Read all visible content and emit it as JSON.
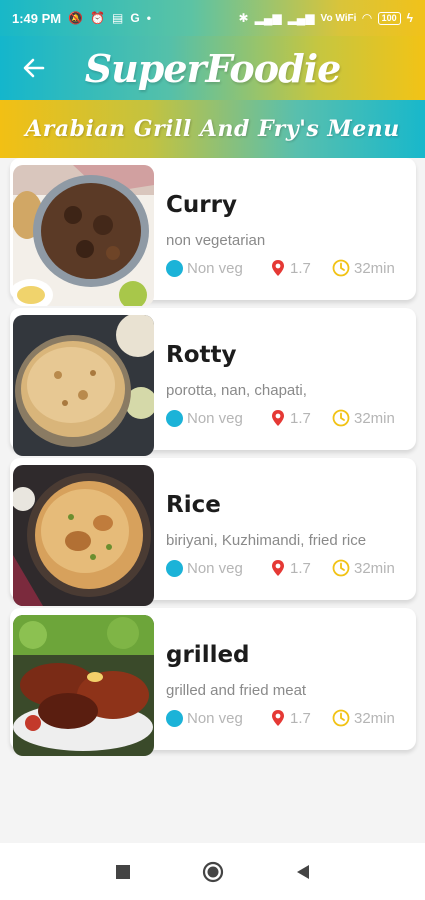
{
  "status_bar": {
    "time": "1:49 PM",
    "network_label": "Vo WiFi",
    "battery": "100"
  },
  "app_bar": {
    "title": "SuperFoodie"
  },
  "menu": {
    "title": "Arabian Grill And Fry's Menu"
  },
  "items": [
    {
      "name": "Curry",
      "description": "non vegetarian",
      "type": "Non veg",
      "rating": "1.7",
      "time": "32min"
    },
    {
      "name": "Rotty",
      "description": "porotta, nan, chapati,",
      "type": "Non veg",
      "rating": "1.7",
      "time": "32min"
    },
    {
      "name": "Rice",
      "description": "biriyani, Kuzhimandi, fried rice",
      "type": "Non veg",
      "rating": "1.7",
      "time": "32min"
    },
    {
      "name": "grilled",
      "description": "grilled and fried meat",
      "type": "Non veg",
      "rating": "1.7",
      "time": "32min"
    }
  ],
  "colors": {
    "teal": "#18b8cb",
    "yellow": "#f2c316",
    "veg_dot": "#1cb3d8",
    "pin": "#e53935",
    "clock": "#f2c316"
  },
  "icons": [
    "back-arrow-icon",
    "location-pin-icon",
    "clock-icon",
    "dot-icon",
    "nav-square-icon",
    "nav-circle-icon",
    "nav-triangle-icon"
  ]
}
